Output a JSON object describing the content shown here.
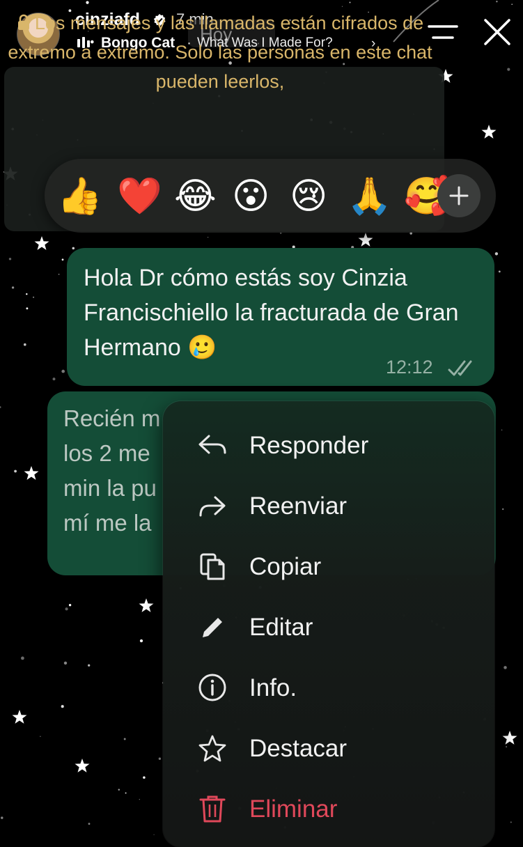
{
  "story": {
    "username": "cinziafd",
    "time_ago": "7 min",
    "music_artist": "Bongo Cat",
    "music_separator": "·",
    "music_title": "What Was I Made For?",
    "music_chevron": "›",
    "menu_icon": "menu-icon",
    "close_icon": "close-icon"
  },
  "chat": {
    "date_chip": "Hoy",
    "encryption_notice": "Los mensajes y las llamadas están cifrados de extremo a extremo. Solo las personas en este chat pueden leerlos,",
    "reactions": [
      "👍",
      "❤️",
      "😂",
      "😮",
      "😢",
      "🙏",
      "🥰"
    ],
    "messages": [
      {
        "text": "Hola Dr cómo estás soy Cinzia Francischiello la fracturada de Gran Hermano 🥲",
        "time": "12:12",
        "status_icon": "double-check-icon"
      },
      {
        "text_lines": [
          "Recién m",
          "los 2 me",
          "min la pu",
          "mí me la"
        ]
      }
    ]
  },
  "context_menu": {
    "items": [
      {
        "label": "Responder",
        "icon": "reply-icon"
      },
      {
        "label": "Reenviar",
        "icon": "forward-icon"
      },
      {
        "label": "Copiar",
        "icon": "copy-icon"
      },
      {
        "label": "Editar",
        "icon": "pencil-icon"
      },
      {
        "label": "Info.",
        "icon": "info-icon"
      },
      {
        "label": "Destacar",
        "icon": "star-icon"
      },
      {
        "label": "Eliminar",
        "icon": "trash-icon"
      }
    ]
  },
  "colors": {
    "bubble": "#144d37",
    "notice_text": "#d9b66a",
    "danger": "#e0485a",
    "background": "#000000"
  }
}
